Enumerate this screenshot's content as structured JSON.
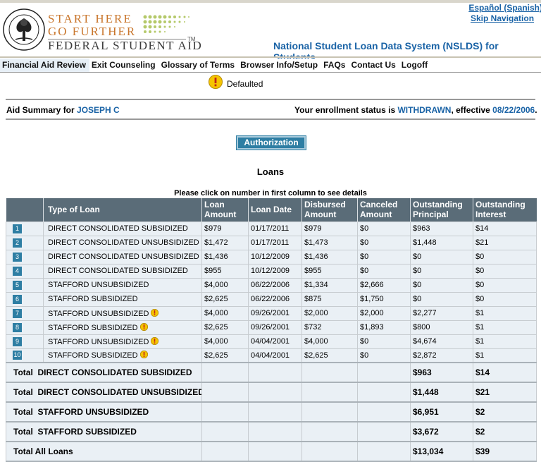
{
  "header": {
    "logo_line1": "START HERE",
    "logo_line2": "GO FURTHER",
    "logo_line3": "FEDERAL STUDENT AID",
    "logo_tm": "TM",
    "lang_link": "Español (Spanish)",
    "skip_link": "Skip Navigation",
    "site_title": "National Student Loan Data System (NSLDS) for Students"
  },
  "nav": {
    "items": [
      "Financial Aid Review",
      "Exit Counseling",
      "Glossary of Terms",
      "Browser Info/Setup",
      "FAQs",
      "Contact Us",
      "Logoff"
    ]
  },
  "legend": {
    "label": "Defaulted",
    "icon": "warning-icon"
  },
  "summary": {
    "prefix": "Aid Summary for",
    "name": "JOSEPH C",
    "enroll_prefix": "Your enrollment status is",
    "status": "WITHDRAWN",
    "effective_prefix": ", effective",
    "date": "08/22/2006",
    "period": "."
  },
  "authorization_button": "Authorization",
  "loans_title": "Loans",
  "instruction": "Please click on number in first column to see details",
  "table": {
    "headers": [
      "",
      "Type of Loan",
      "Loan Amount",
      "Loan Date",
      "Disbursed Amount",
      "Canceled Amount",
      "Outstanding Principal",
      "Outstanding Interest"
    ],
    "rows": [
      {
        "num": "1",
        "type": "DIRECT CONSOLIDATED SUBSIDIZED",
        "defaulted": false,
        "amount": "$979",
        "date": "01/17/2011",
        "disbursed": "$979",
        "canceled": "$0",
        "principal": "$963",
        "interest": "$14"
      },
      {
        "num": "2",
        "type": "DIRECT CONSOLIDATED UNSUBSIDIZED",
        "defaulted": false,
        "amount": "$1,472",
        "date": "01/17/2011",
        "disbursed": "$1,473",
        "canceled": "$0",
        "principal": "$1,448",
        "interest": "$21"
      },
      {
        "num": "3",
        "type": "DIRECT CONSOLIDATED UNSUBSIDIZED",
        "defaulted": false,
        "amount": "$1,436",
        "date": "10/12/2009",
        "disbursed": "$1,436",
        "canceled": "$0",
        "principal": "$0",
        "interest": "$0"
      },
      {
        "num": "4",
        "type": "DIRECT CONSOLIDATED SUBSIDIZED",
        "defaulted": false,
        "amount": "$955",
        "date": "10/12/2009",
        "disbursed": "$955",
        "canceled": "$0",
        "principal": "$0",
        "interest": "$0"
      },
      {
        "num": "5",
        "type": "STAFFORD UNSUBSIDIZED",
        "defaulted": false,
        "amount": "$4,000",
        "date": "06/22/2006",
        "disbursed": "$1,334",
        "canceled": "$2,666",
        "principal": "$0",
        "interest": "$0"
      },
      {
        "num": "6",
        "type": "STAFFORD SUBSIDIZED",
        "defaulted": false,
        "amount": "$2,625",
        "date": "06/22/2006",
        "disbursed": "$875",
        "canceled": "$1,750",
        "principal": "$0",
        "interest": "$0"
      },
      {
        "num": "7",
        "type": "STAFFORD UNSUBSIDIZED",
        "defaulted": true,
        "amount": "$4,000",
        "date": "09/26/2001",
        "disbursed": "$2,000",
        "canceled": "$2,000",
        "principal": "$2,277",
        "interest": "$1"
      },
      {
        "num": "8",
        "type": "STAFFORD SUBSIDIZED",
        "defaulted": true,
        "amount": "$2,625",
        "date": "09/26/2001",
        "disbursed": "$732",
        "canceled": "$1,893",
        "principal": "$800",
        "interest": "$1"
      },
      {
        "num": "9",
        "type": "STAFFORD UNSUBSIDIZED",
        "defaulted": true,
        "amount": "$4,000",
        "date": "04/04/2001",
        "disbursed": "$4,000",
        "canceled": "$0",
        "principal": "$4,674",
        "interest": "$1"
      },
      {
        "num": "10",
        "type": "STAFFORD SUBSIDIZED",
        "defaulted": true,
        "amount": "$2,625",
        "date": "04/04/2001",
        "disbursed": "$2,625",
        "canceled": "$0",
        "principal": "$2,872",
        "interest": "$1"
      }
    ],
    "totals": [
      {
        "label": "Total  DIRECT CONSOLIDATED SUBSIDIZED",
        "principal": "$963",
        "interest": "$14"
      },
      {
        "label": "Total  DIRECT CONSOLIDATED UNSUBSIDIZED",
        "principal": "$1,448",
        "interest": "$21"
      },
      {
        "label": "Total  STAFFORD UNSUBSIDIZED",
        "principal": "$6,951",
        "interest": "$2"
      },
      {
        "label": "Total  STAFFORD SUBSIDIZED",
        "principal": "$3,672",
        "interest": "$2"
      },
      {
        "label": "Total All Loans",
        "principal": "$13,034",
        "interest": "$39"
      }
    ]
  },
  "colors": {
    "link_blue": "#1a63a6",
    "table_header": "#5a6c78",
    "row_bg": "#eaf0f5",
    "button": "#2e7ea3",
    "logo_orange": "#c9762c",
    "warning_yellow": "#f5c400"
  }
}
